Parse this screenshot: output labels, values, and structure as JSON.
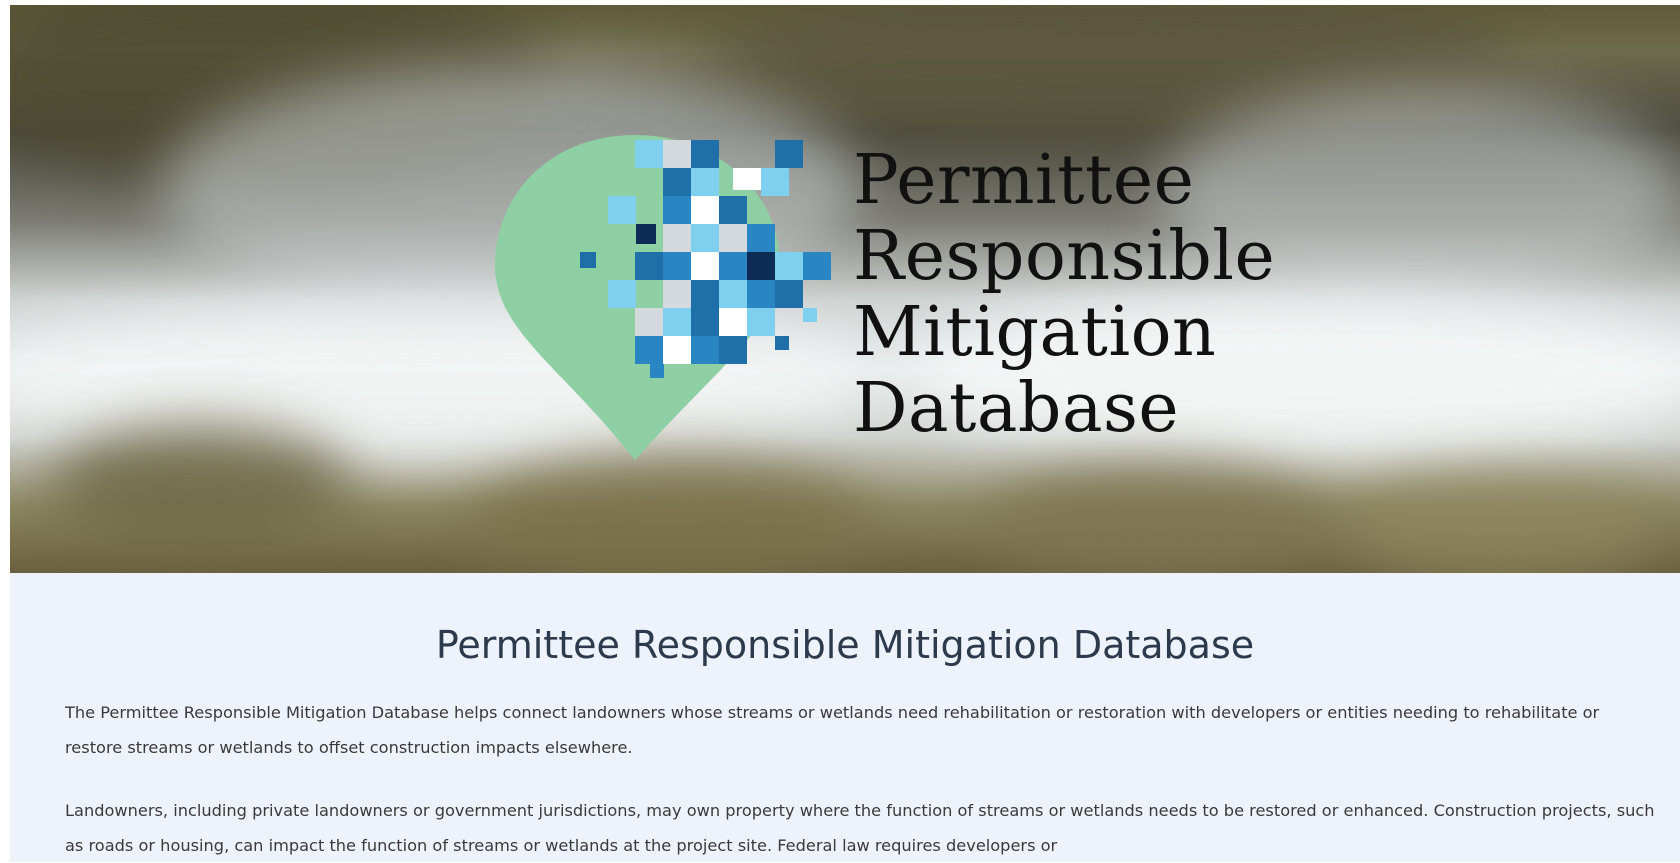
{
  "hero": {
    "logo_lines": [
      "Permittee",
      "Responsible",
      "Mitigation",
      "Database"
    ]
  },
  "main": {
    "heading": "Permittee Responsible Mitigation Database",
    "paragraph1": "The Permittee Responsible Mitigation Database helps connect landowners whose streams or wetlands need rehabilitation or restoration with developers or entities needing to rehabilitate or restore streams or wetlands to offset construction impacts elsewhere.",
    "paragraph2": "Landowners, including private landowners or government jurisdictions, may own property where the function of streams or wetlands needs to be restored or enhanced. Construction projects, such as roads or housing, can impact the function of streams or wetlands at the project site. Federal law requires developers or"
  },
  "colors": {
    "logo_green": "#8ecfa3",
    "heading": "#2b3a4d",
    "content_bg": "#eef3fb"
  },
  "icons": {
    "logo": "map-pin-pixel-logo-icon"
  }
}
